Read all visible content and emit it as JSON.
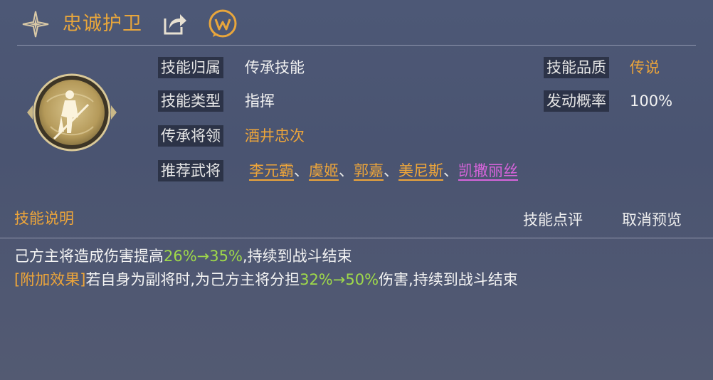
{
  "header": {
    "title": "忠诚护卫",
    "icons": [
      "star-icon",
      "share-icon",
      "chat-icon"
    ]
  },
  "info": {
    "belong_label": "技能归属",
    "belong_value": "传承技能",
    "type_label": "技能类型",
    "type_value": "指挥",
    "general_label": "传承将领",
    "general_value": "酒井忠次",
    "recommend_label": "推荐武将",
    "recommend": [
      {
        "name": "李元霸",
        "color": "#eda53a"
      },
      {
        "name": "虞姬",
        "color": "#eda53a"
      },
      {
        "name": "郭嘉",
        "color": "#eda53a"
      },
      {
        "name": "美尼斯",
        "color": "#eda53a"
      },
      {
        "name": "凯撒丽丝",
        "color": "#d864dc"
      }
    ],
    "separator": "、",
    "quality_label": "技能品质",
    "quality_value": "传说",
    "chance_label": "发动概率",
    "chance_value": "100%"
  },
  "section": {
    "title": "技能说明",
    "review_button": "技能点评",
    "cancel_button": "取消预览"
  },
  "description": {
    "line1_prefix": "己方主将造成伤害提高",
    "line1_value": "26%→35%",
    "line1_suffix": ",持续到战斗结束",
    "line2_tag": "[附加效果]",
    "line2_prefix": "若自身为副将时,为己方主将分担",
    "line2_value": "32%→50%",
    "line2_suffix": "伤害,持续到战斗结束"
  },
  "colors": {
    "accent_gold": "#eda53a",
    "purple": "#d864dc",
    "green": "#9fd94a"
  }
}
